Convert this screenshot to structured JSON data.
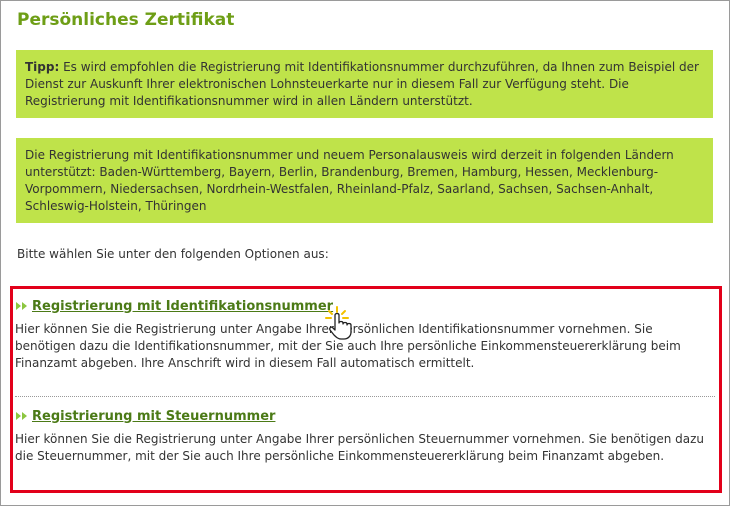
{
  "page": {
    "title": "Persönliches Zertifikat"
  },
  "tip_box": {
    "label": "Tipp:",
    "text": " Es wird empfohlen die Registrierung mit Identifikationsnummer durchzuführen, da Ihnen zum Beispiel der Dienst zur Auskunft Ihrer elektronischen Lohnsteuerkarte nur in diesem Fall zur Verfügung steht. Die Registrierung mit Identifikationsnummer wird in allen Ländern unterstützt."
  },
  "laender_box": {
    "text": "Die Registrierung mit Identifikationsnummer und neuem Personalausweis wird derzeit in folgenden Ländern unterstützt: Baden-Württemberg, Bayern, Berlin, Brandenburg, Bremen, Hamburg, Hessen, Mecklenburg-Vorpommern, Niedersachsen, Nordrhein-Westfalen, Rheinland-Pfalz, Saarland, Sachsen, Sachsen-Anhalt, Schleswig-Holstein, Thüringen"
  },
  "prompt": "Bitte wählen Sie unter den folgenden Optionen aus:",
  "options": [
    {
      "link": "Registrierung mit Identifikationsnummer",
      "description": "Hier können Sie die Registrierung unter Angabe Ihrer persönlichen Identifikationsnummer vornehmen. Sie benötigen dazu die Identifikationsnummer, mit der Sie auch Ihre persönliche Einkommensteuererklärung beim Finanzamt abgeben. Ihre Anschrift wird in diesem Fall automatisch ermittelt."
    },
    {
      "link": "Registrierung mit Steuernummer",
      "description": "Hier können Sie die Registrierung unter Angabe Ihrer persönlichen Steuernummer vornehmen. Sie benötigen dazu die Steuernummer, mit der Sie auch Ihre persönliche Einkommensteuererklärung beim Finanzamt abgeben."
    }
  ],
  "colors": {
    "title_green": "#6e9e16",
    "box_green": "#bfe34a",
    "link_green": "#4b7a16",
    "highlight_red": "#e2001a"
  },
  "icons": {
    "bullet": "double-arrow-right-icon",
    "cursor": "hand-pointer-cursor-icon"
  }
}
